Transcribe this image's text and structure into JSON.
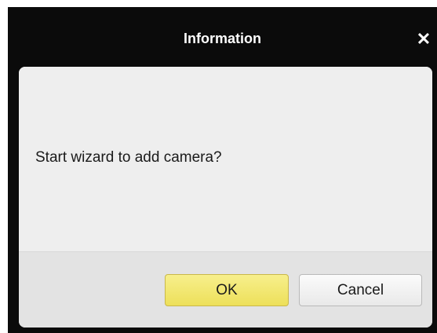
{
  "dialog": {
    "title": "Information",
    "close_icon": "close-icon",
    "close_glyph": "✕",
    "message": "Start wizard to add camera?",
    "ok_label": "OK",
    "cancel_label": "Cancel"
  },
  "colors": {
    "frame": "#0b0b0b",
    "panel": "#eeeeee",
    "footer": "#e3e3e3",
    "ok_button": "#f2e670",
    "cancel_button": "#f3f3f3"
  }
}
